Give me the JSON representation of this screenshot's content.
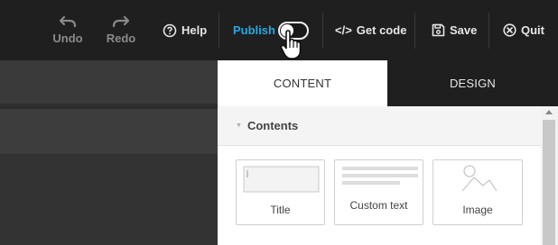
{
  "toolbar": {
    "undo_label": "Undo",
    "redo_label": "Redo",
    "help_label": "Help",
    "publish_label": "Publish",
    "publish_toggle_on": false,
    "getcode_label": "Get code",
    "save_label": "Save",
    "quit_label": "Quit"
  },
  "panel": {
    "tabs": [
      {
        "label": "CONTENT",
        "active": true
      },
      {
        "label": "DESIGN",
        "active": false
      }
    ],
    "section_title": "Contents",
    "widgets": [
      {
        "label": "Title",
        "icon": "title-placeholder-icon"
      },
      {
        "label": "Custom text",
        "icon": "text-lines-icon"
      },
      {
        "label": "Image",
        "icon": "image-placeholder-icon"
      }
    ]
  },
  "colors": {
    "toolbar_bg": "#1f1f1f",
    "publish_accent": "#27a9e1",
    "canvas_bg": "#333333",
    "design_tab_bg": "#1f1f1f"
  }
}
